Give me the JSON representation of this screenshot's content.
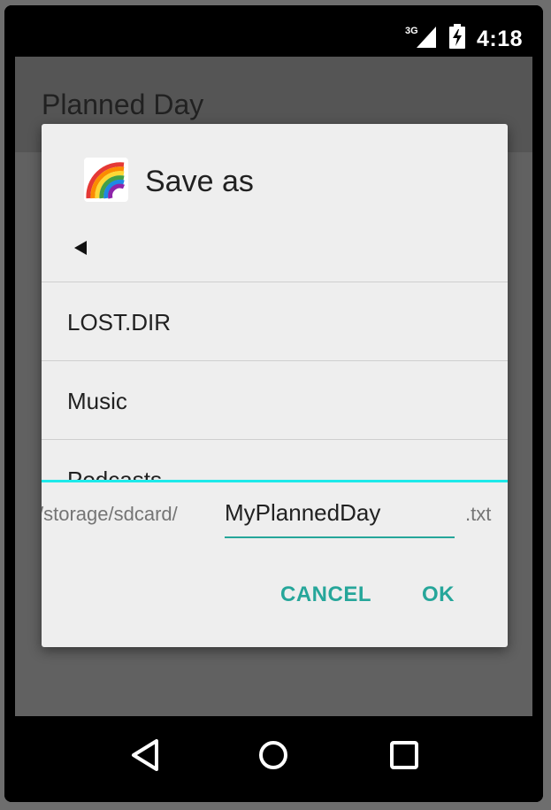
{
  "status_bar": {
    "network_label": "3G",
    "time": "4:18",
    "network_icon": "signal-3g-icon",
    "battery_icon": "battery-charging-icon"
  },
  "app": {
    "title": "Planned Day"
  },
  "dialog": {
    "title": "Save as",
    "icon": "rainbow-icon",
    "back_icon": "back-arrow-icon",
    "files": [
      {
        "name": "LOST.DIR"
      },
      {
        "name": "Music"
      },
      {
        "name": "Podcasts"
      }
    ],
    "path_prefix": "/storage/sdcard/",
    "filename_value": "MyPlannedDay",
    "extension": ".txt",
    "cancel_label": "CANCEL",
    "ok_label": "OK"
  },
  "nav_bar": {
    "back_icon": "nav-back-icon",
    "home_icon": "nav-home-icon",
    "recents_icon": "nav-recents-icon"
  },
  "colors": {
    "accent": "#26a69a",
    "scroll_edge": "#1de9e9",
    "dialog_bg": "#eeeeee"
  }
}
